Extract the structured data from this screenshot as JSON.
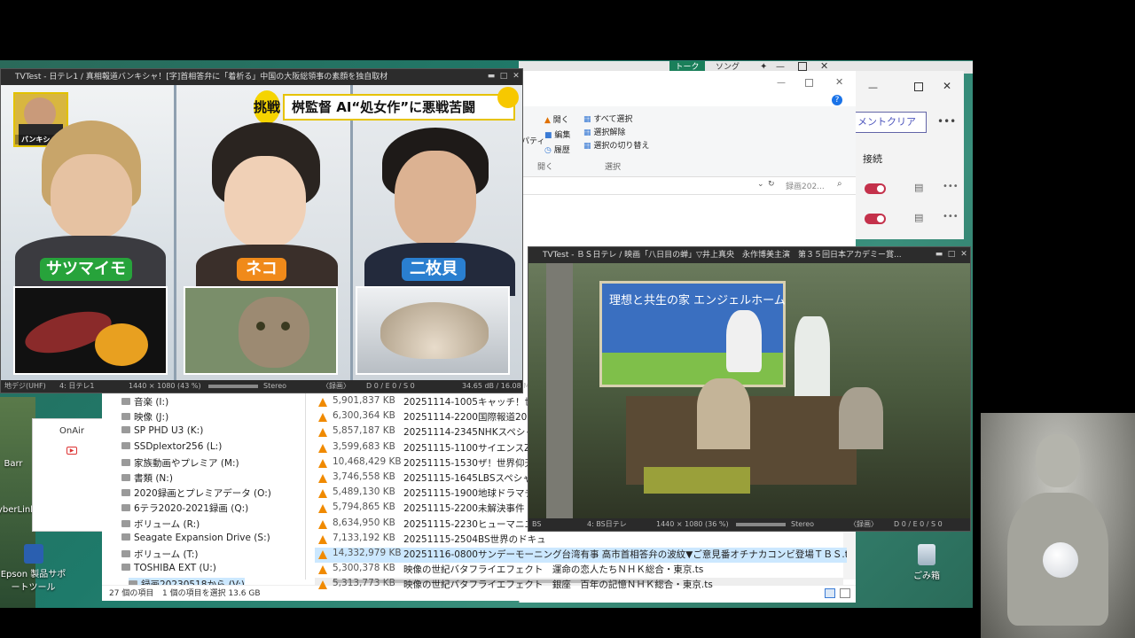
{
  "tv1": {
    "title": "TVTest - 日テレ1 / 真相報道バンキシャ！[字]首相答弁に「着析る」中国の大阪総領事の素顔を独自取材",
    "banner": "桝監督 AI“処女作”に悪戦苦闘",
    "banner_tag": "挑戦",
    "captions": [
      "サツマイモ",
      "ネコ",
      "二枚貝"
    ],
    "logo_text": "バンキシャ!",
    "status": {
      "channel_type": "地デジ(UHF)",
      "channel": "4: 日テレ1",
      "resolution": "1440 × 1080 (43 %)",
      "audio": "Stereo",
      "rec": "〈録画〉",
      "drop": "D 0 / E 0 / S 0",
      "signal": "34.65 dB / 16.08 M"
    }
  },
  "tv2": {
    "title": "TVTest - ＢＳ日テレ / 映画「八日目の蝉」▽井上真央　永作博美主演　第３５回日本アカデミー賞...",
    "sign": "理想と共生の家 エンジェルホーム",
    "status": {
      "channel_type": "BS",
      "channel": "4: BS日テレ",
      "resolution": "1440 × 1080 (36 %)",
      "audio": "Stereo",
      "rec": "〈録画〉",
      "drop": "D 0 / E 0 / S 0"
    }
  },
  "explorer": {
    "ribbon": {
      "open": "開く",
      "edit": "編集",
      "history": "履歴",
      "open_group": "開く",
      "select_all": "すべて選択",
      "select_none": "選択解除",
      "invert": "選択の切り替え",
      "select_group": "選択",
      "property": "パティ"
    },
    "search_placeholder": "録画202...",
    "nav": [
      "音楽 (I:)",
      "映像 (J:)",
      "SP PHD U3 (K:)",
      "SSDplextor256 (L:)",
      "家族動画やプレミア (M:)",
      "書類 (N:)",
      "2020録画とプレミアデータ (O:)",
      "6テラ2020-2021録画 (Q:)",
      "ボリューム (R:)",
      "Seagate Expansion Drive (S:)",
      "ボリューム (T:)",
      "TOSHIBA EXT (U:)",
      "録画20230518から (V:)"
    ],
    "files": [
      {
        "size": "5,901,837 KB",
        "name": "20251114-1005キャッチ！世界の"
      },
      {
        "size": "6,300,364 KB",
        "name": "20251114-2200国際報道2025"
      },
      {
        "size": "5,857,187 KB",
        "name": "20251114-2345NHKスペシャル選"
      },
      {
        "size": "3,599,683 KB",
        "name": "20251115-1100サイエンスZERO"
      },
      {
        "size": "10,468,429 KB",
        "name": "20251115-1530ザ！世界仰天ニ"
      },
      {
        "size": "3,746,558 KB",
        "name": "20251115-1645LBSスペシャル【世"
      },
      {
        "size": "5,489,130 KB",
        "name": "20251115-1900地球ドラマチック"
      },
      {
        "size": "5,794,865 KB",
        "name": "20251115-2200未解決事件　F"
      },
      {
        "size": "8,634,950 KB",
        "name": "20251115-2230ヒューマニエンス"
      },
      {
        "size": "7,133,192 KB",
        "name": "20251115-2504BS世界のドキュ"
      },
      {
        "size": "14,332,979 KB",
        "name": "20251116-0800サンデーモーニング台湾有事 高市首相答弁の波紋▼ご意見番オチナカコンビ登場ＴＢＳ.ts"
      },
      {
        "size": "5,300,378 KB",
        "name": "映像の世紀バタフライエフェクト　運命の恋人たちＮＨＫ総合・東京.ts"
      },
      {
        "size": "5,313,773 KB",
        "name": "映像の世紀バタフライエフェクト　銀座　百年の記憶ＮＨＫ総合・東京.ts"
      }
    ],
    "status_count": "27 個の項目",
    "status_selected": "1 個の項目を選択  13.6 GB"
  },
  "teams": {
    "clear_label": "メントクリア",
    "connect_label": "接続"
  },
  "topstrip": {
    "tab1": "トーク",
    "tab2": "ソング"
  },
  "onair": {
    "label": "OnAir"
  },
  "desktop_icons": {
    "recycle": "ごみ箱",
    "epson": "Epson 製品サポートツール",
    "cyberlink": "CyberLink",
    "bar": "Barr"
  }
}
